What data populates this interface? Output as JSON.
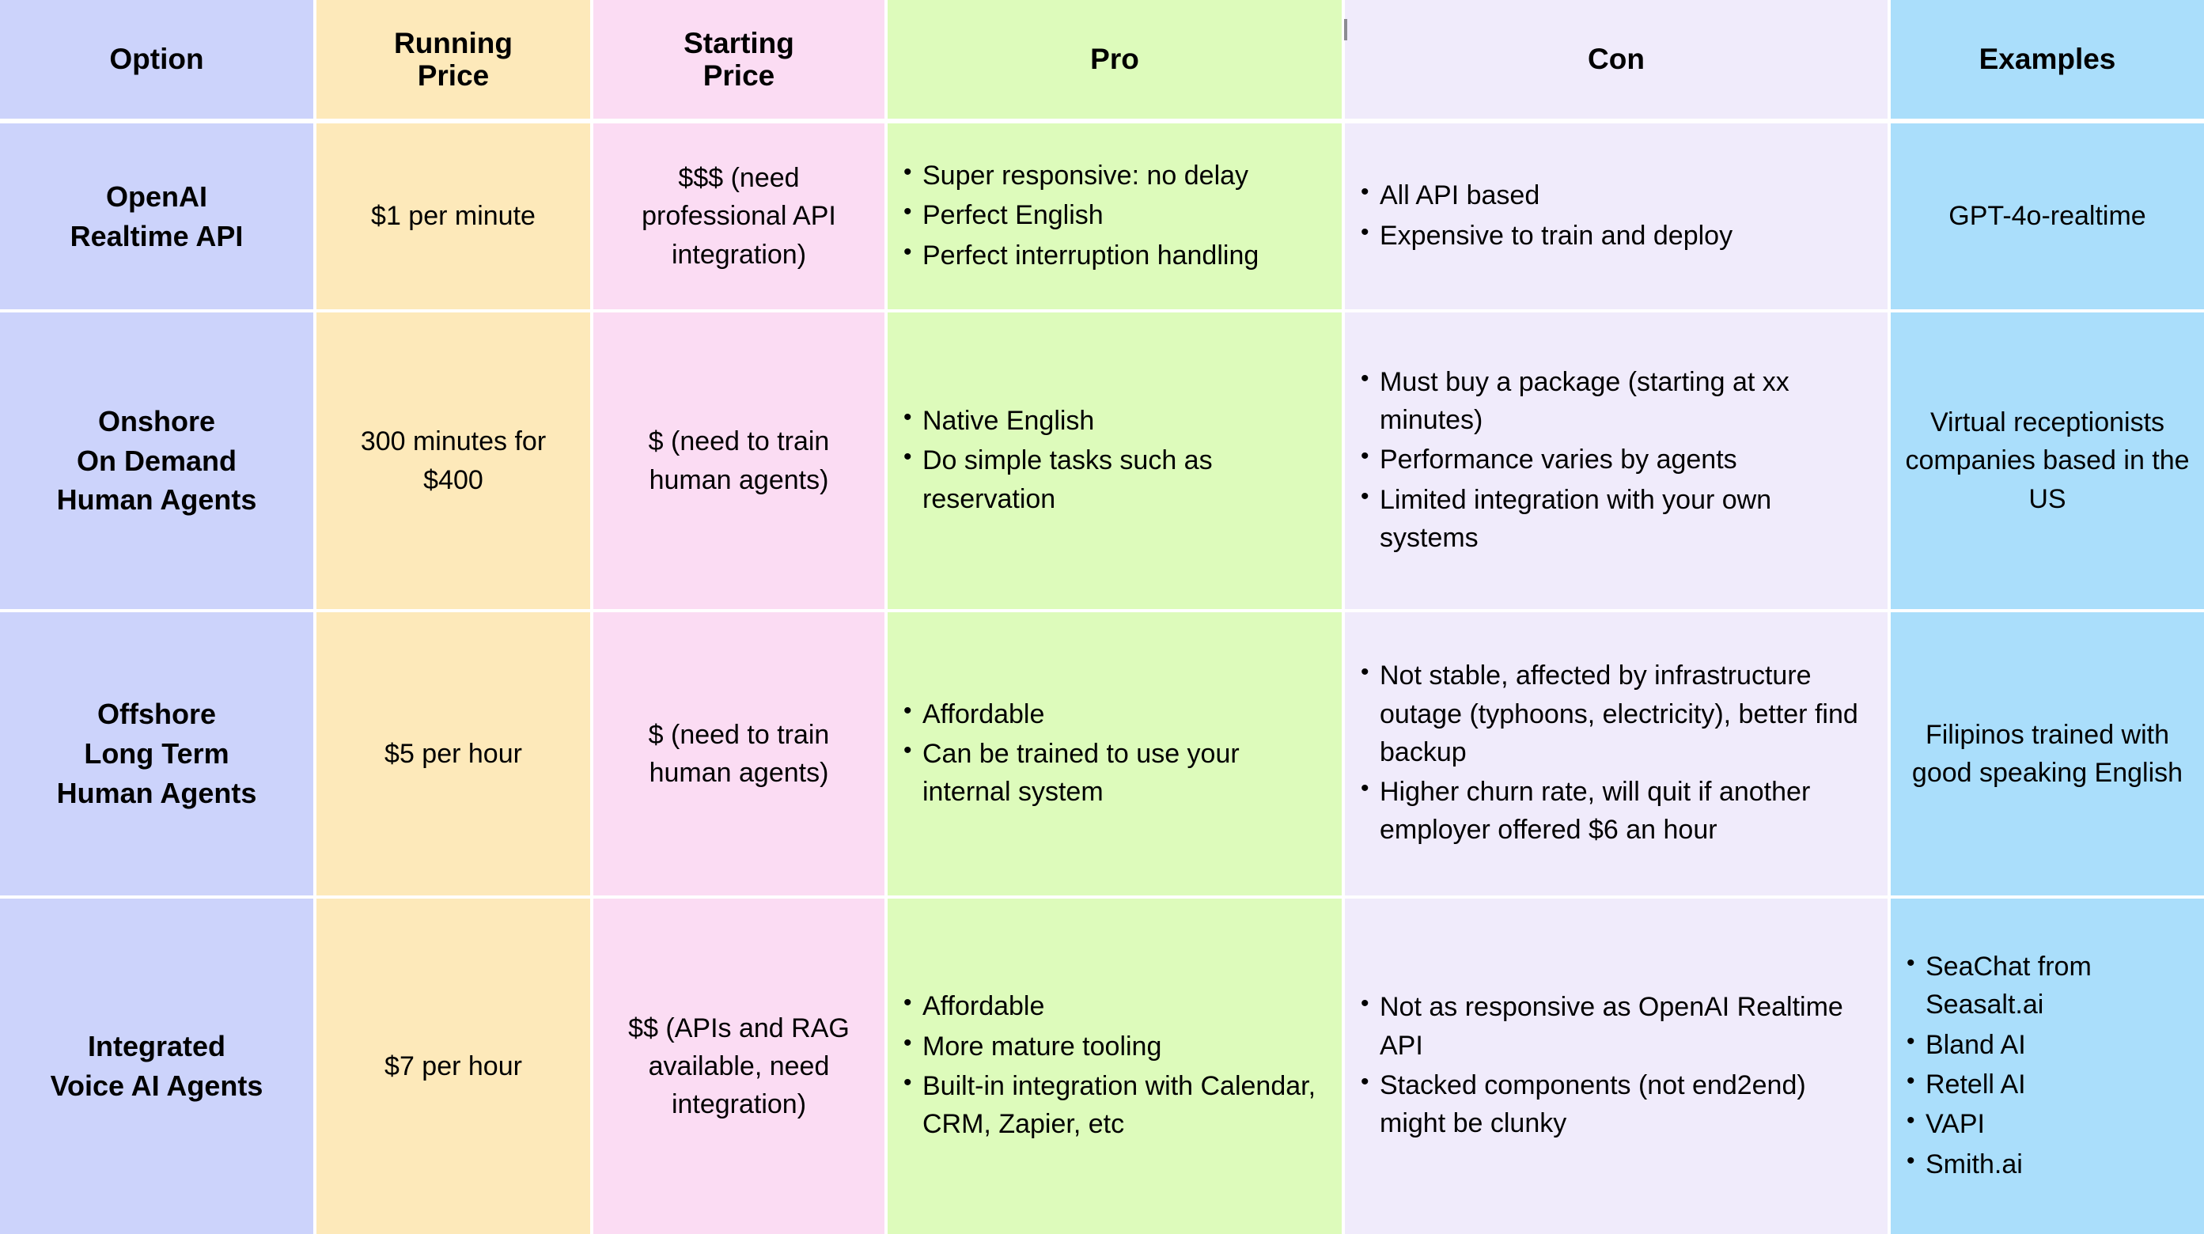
{
  "table": {
    "columns": [
      {
        "key": "option",
        "label": "Option",
        "color": "#ccd3fb"
      },
      {
        "key": "running",
        "label": "Running\nPrice",
        "color": "#fde9ba"
      },
      {
        "key": "starting",
        "label": "Starting\nPrice",
        "color": "#fbdcf3"
      },
      {
        "key": "pro",
        "label": "Pro",
        "color": "#ddfbbb"
      },
      {
        "key": "con",
        "label": "Con",
        "color": "#f0ebfb"
      },
      {
        "key": "examples",
        "label": "Examples",
        "color": "#aadefb"
      }
    ],
    "headers": {
      "option": "Option",
      "running_line1": "Running",
      "running_line2": "Price",
      "starting_line1": "Starting",
      "starting_line2": "Price",
      "pro": "Pro",
      "con": "Con",
      "examples": "Examples"
    },
    "rows": [
      {
        "option_lines": [
          "OpenAI",
          "Realtime API"
        ],
        "running_price": "$1 per minute",
        "starting_price": "$$$ (need professional API integration)",
        "pro": [
          "Super responsive: no delay",
          "Perfect English",
          "Perfect interruption handling"
        ],
        "con": [
          "All API based",
          "Expensive to train and deploy"
        ],
        "examples_text": "GPT-4o-realtime",
        "examples_bullets": []
      },
      {
        "option_lines": [
          "Onshore",
          "On Demand",
          "Human Agents"
        ],
        "running_price": "300 minutes for $400",
        "starting_price": "$ (need to train human agents)",
        "pro": [
          "Native English",
          "Do simple tasks such as reservation"
        ],
        "con": [
          "Must buy a package (starting at xx minutes)",
          "Performance varies by agents",
          "Limited integration with your own systems"
        ],
        "examples_text": "Virtual receptionists companies based in the US",
        "examples_bullets": []
      },
      {
        "option_lines": [
          "Offshore",
          "Long Term",
          "Human Agents"
        ],
        "running_price": "$5 per hour",
        "starting_price": "$ (need to train human agents)",
        "pro": [
          "Affordable",
          "Can be trained to use your internal system"
        ],
        "con": [
          "Not stable, affected by infrastructure outage (typhoons, electricity), better find backup",
          "Higher churn rate, will quit if another employer offered $6 an hour"
        ],
        "examples_text": "Filipinos trained with good speaking English",
        "examples_bullets": []
      },
      {
        "option_lines": [
          "Integrated",
          "Voice AI Agents"
        ],
        "running_price": "$7 per hour",
        "starting_price": "$$ (APIs and RAG available, need integration)",
        "pro": [
          "Affordable",
          "More mature tooling",
          "Built-in integration with Calendar, CRM, Zapier, etc"
        ],
        "con": [
          "Not as responsive as OpenAI Realtime API",
          "Stacked components (not end2end) might be clunky"
        ],
        "examples_text": "",
        "examples_bullets": [
          "SeaChat from Seasalt.ai",
          "Bland AI",
          "Retell AI",
          "VAPI",
          "Smith.ai"
        ]
      }
    ]
  }
}
